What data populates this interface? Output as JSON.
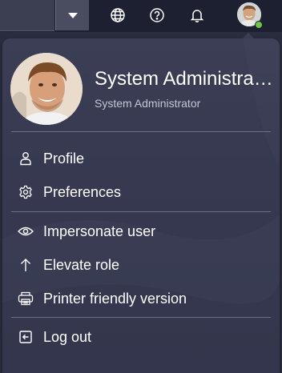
{
  "topbar": {
    "dropdown_icon": "caret-down-icon",
    "icons": [
      "globe-icon",
      "help-icon",
      "bell-icon"
    ],
    "avatar_icon": "avatar",
    "presence_color": "#6ec543"
  },
  "profile": {
    "name": "System Administra…",
    "role": "System Administrator"
  },
  "menu": {
    "profile": {
      "label": "Profile",
      "icon": "person-icon"
    },
    "preferences": {
      "label": "Preferences",
      "icon": "gear-icon"
    },
    "impersonate": {
      "label": "Impersonate user",
      "icon": "eye-icon"
    },
    "elevate": {
      "label": "Elevate role",
      "icon": "arrow-up-icon"
    },
    "printer": {
      "label": "Printer friendly version",
      "icon": "printer-icon"
    },
    "logout": {
      "label": "Log out",
      "icon": "logout-icon"
    }
  },
  "colors": {
    "panel_bg": "#373a51",
    "topbar_bg": "#1d2030",
    "text": "#ffffff",
    "subtext": "#c4c6d4"
  }
}
